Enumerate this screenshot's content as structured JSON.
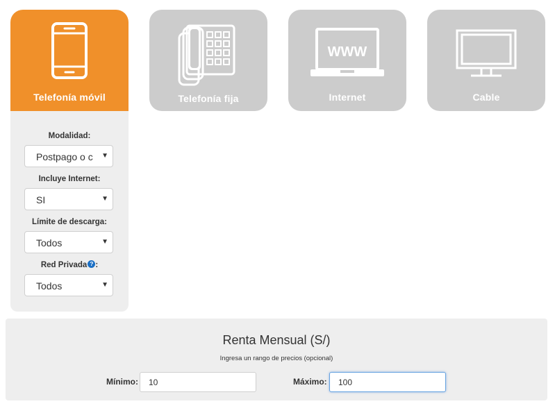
{
  "categories": [
    {
      "label": "Telefonía móvil",
      "icon": "mobile-phone-icon",
      "active": true
    },
    {
      "label": "Telefonía fija",
      "icon": "desk-phone-icon",
      "active": false
    },
    {
      "label": "Internet",
      "icon": "laptop-www-icon",
      "active": false
    },
    {
      "label": "Cable",
      "icon": "tv-monitor-icon",
      "active": false
    }
  ],
  "internet_icon_text": "WWW",
  "filters": {
    "modalidad": {
      "label": "Modalidad:",
      "value": "Postpago o c"
    },
    "incluye_internet": {
      "label": "Incluye Internet:",
      "value": "SI"
    },
    "limite_descarga": {
      "label": "Límite de descarga:",
      "value": "Todos"
    },
    "red_privada": {
      "label": "Red Privada",
      "label_suffix": ":",
      "help": "?",
      "value": "Todos"
    },
    "arrow": "▼"
  },
  "price": {
    "title": "Renta Mensual (S/)",
    "subtitle": "Ingresa un rango de precios (opcional)",
    "min_label": "Mínimo:",
    "min_value": "10",
    "max_label": "Máximo:",
    "max_value": "100"
  },
  "colors": {
    "active": "#f0902a",
    "inactive": "#cccccc",
    "panel": "#eeeeee",
    "help": "#1a6fc4"
  }
}
